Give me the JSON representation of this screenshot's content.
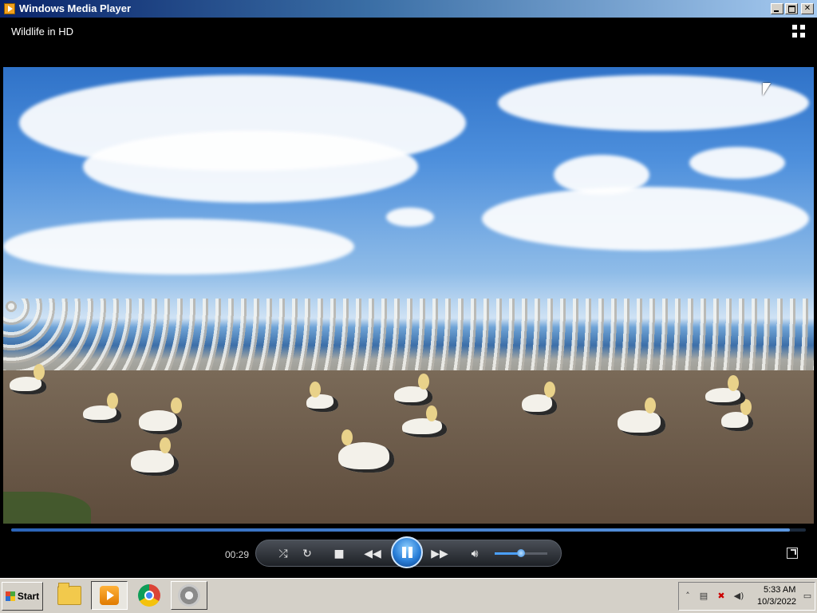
{
  "window": {
    "title": "Windows Media Player"
  },
  "topbar": {
    "media_title": "Wildlife in HD"
  },
  "controls": {
    "time_elapsed": "00:29",
    "progress": 0.98,
    "volume": 0.5
  },
  "taskbar": {
    "start_label": "Start",
    "apps": [
      "file-explorer-icon",
      "windows-media-player-icon",
      "chrome-icon",
      "settings-gear-icon"
    ],
    "clock": {
      "time": "5:33 AM",
      "date": "10/3/2022"
    }
  },
  "colors": {
    "accent": "#2a7fd8",
    "titlebar": "#0a246a"
  }
}
